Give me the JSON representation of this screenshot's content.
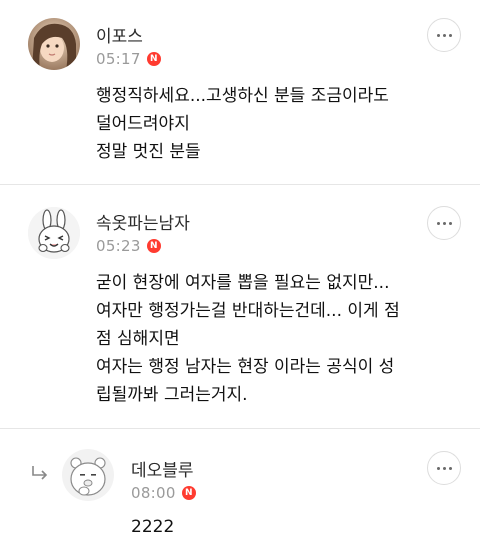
{
  "comments": [
    {
      "author": "이포스",
      "time": "05:17",
      "badge": "N",
      "lines": [
        "행정직하세요...고생하신 분들 조금이라도",
        "덜어드려야지",
        "정말 멋진 분들"
      ]
    },
    {
      "author": "속옷파는남자",
      "time": "05:23",
      "badge": "N",
      "lines": [
        "굳이 현장에 여자를 뽑을 필요는 없지만...",
        "여자만 행정가는걸 반대하는건데... 이게 점",
        "점 심해지면",
        "여자는 행정 남자는 현장  이라는 공식이 성",
        "립될까봐 그러는거지."
      ]
    },
    {
      "author": "데오블루",
      "time": "08:00",
      "badge": "N",
      "lines": [
        "2222"
      ]
    }
  ],
  "colors": {
    "badge": "#ff3b30",
    "time": "#9a9a9a",
    "divider": "#e6e6e6"
  },
  "icons": {
    "more": "more-horizontal-icon",
    "reply": "reply-arrow-icon",
    "new": "new-badge-icon"
  }
}
